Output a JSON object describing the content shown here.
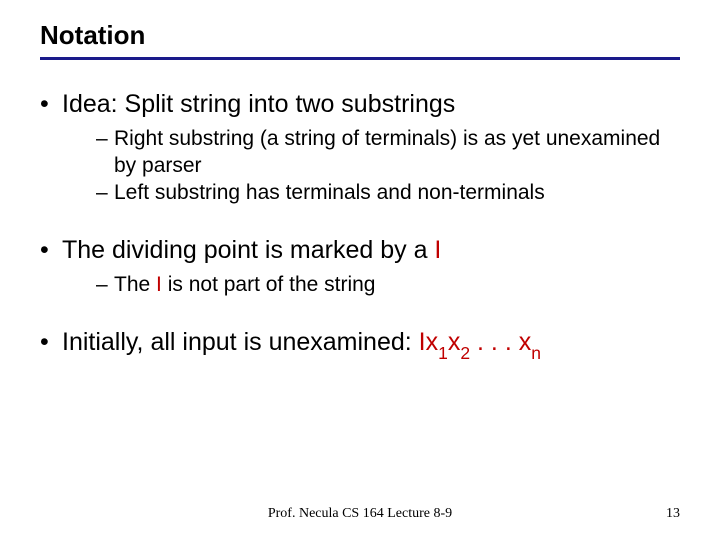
{
  "title": "Notation",
  "bullets": {
    "b1": "Idea: Split string into two substrings",
    "b1_sub1": "Right substring (a string of terminals) is as yet unexamined by parser",
    "b1_sub2": "Left substring has terminals and non-terminals",
    "b2_pre": "The dividing point is marked by a ",
    "b2_marker": "I",
    "b2_sub1_pre": "The ",
    "b2_sub1_marker": "I",
    "b2_sub1_post": " is not part of the string",
    "b3_pre": "Initially, all input is unexamined: ",
    "b3_marker": "I",
    "b3_x": "x",
    "b3_s1": "1",
    "b3_s2": "2",
    "b3_dots": " . . . ",
    "b3_sn": "n"
  },
  "footer": {
    "center": "Prof. Necula  CS 164  Lecture 8-9",
    "page": "13"
  }
}
